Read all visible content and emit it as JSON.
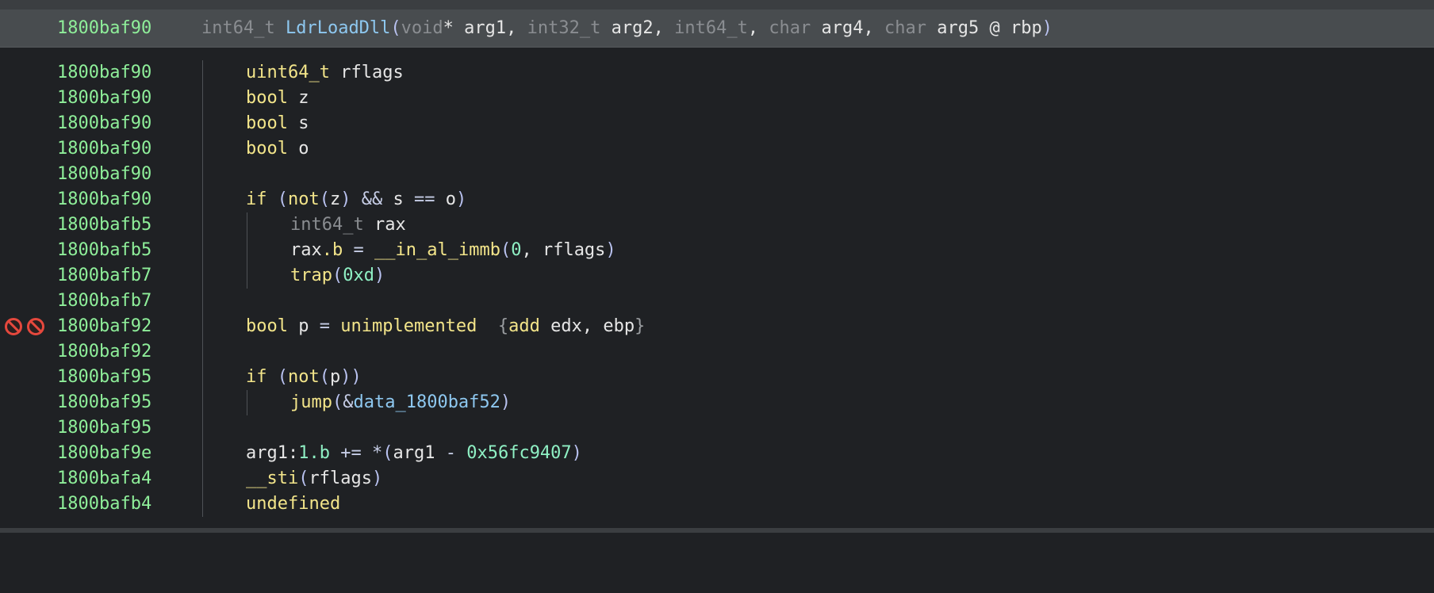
{
  "header": {
    "address": "1800baf90",
    "return_type": "int64_t",
    "function_name": "LdrLoadDll",
    "arg1_type": "void",
    "arg1_ptr": "*",
    "arg1_name": "arg1",
    "arg2_type": "int32_t",
    "arg2_name": "arg2",
    "arg3_type": "int64_t",
    "arg4_type": "char",
    "arg4_name": "arg4",
    "arg5_type": "char",
    "arg5_name": "arg5",
    "arg5_reg": "@ rbp"
  },
  "lines": [
    {
      "address": "1800baf90"
    },
    {
      "address": "1800baf90"
    },
    {
      "address": "1800baf90"
    },
    {
      "address": "1800baf90"
    },
    {
      "address": "1800baf90"
    },
    {
      "address": "1800baf90"
    },
    {
      "address": "1800bafb5"
    },
    {
      "address": "1800bafb5"
    },
    {
      "address": "1800bafb7"
    },
    {
      "address": "1800bafb7"
    },
    {
      "address": "1800baf92"
    },
    {
      "address": "1800baf92"
    },
    {
      "address": "1800baf95"
    },
    {
      "address": "1800baf95"
    },
    {
      "address": "1800baf95"
    },
    {
      "address": "1800baf9e"
    },
    {
      "address": "1800bafa4"
    },
    {
      "address": "1800bafb4"
    }
  ],
  "code": {
    "l0_type": "uint64_t",
    "l0_name": "rflags",
    "l1_type": "bool",
    "l1_name": "z",
    "l2_type": "bool",
    "l2_name": "s",
    "l3_type": "bool",
    "l3_name": "o",
    "l5_if": "if",
    "l5_not": "not",
    "l5_z": "z",
    "l5_and": "&&",
    "l5_s": "s",
    "l5_eq": "==",
    "l5_o": "o",
    "l6_type": "int64_t",
    "l6_name": "rax",
    "l7_lhs": "rax",
    "l7_field": ".b",
    "l7_assign": "=",
    "l7_fn": "__in_al_immb",
    "l7_num": "0",
    "l7_arg": "rflags",
    "l8_fn": "trap",
    "l8_num": "0xd",
    "l10_type": "bool",
    "l10_name": "p",
    "l10_assign": "=",
    "l10_val": "unimplemented",
    "l10_asm_mn": "add",
    "l10_asm_ops": "edx, ebp",
    "l12_if": "if",
    "l12_not": "not",
    "l12_p": "p",
    "l13_fn": "jump",
    "l13_amp": "&",
    "l13_target": "data_1800baf52",
    "l15_lhs": "arg1",
    "l15_colon": ":",
    "l15_field": "1.b",
    "l15_op": "+=",
    "l15_deref": "*",
    "l15_arg": "arg1",
    "l15_minus": "-",
    "l15_num": "0x56fc9407",
    "l16_fn": "__sti",
    "l16_arg": "rflags",
    "l17_val": "undefined"
  },
  "warnings": {
    "row": 10,
    "icons": [
      "no-entry-icon",
      "no-entry-icon"
    ]
  },
  "colors": {
    "background": "#1f2124",
    "header_background": "#484c4f",
    "address": "#8fef9a",
    "type_keyword": "#f3e58a",
    "dim_type": "#8a8d91",
    "function_blue": "#8ec8f0",
    "number": "#8ff0c4",
    "warning": "#e5483d"
  }
}
